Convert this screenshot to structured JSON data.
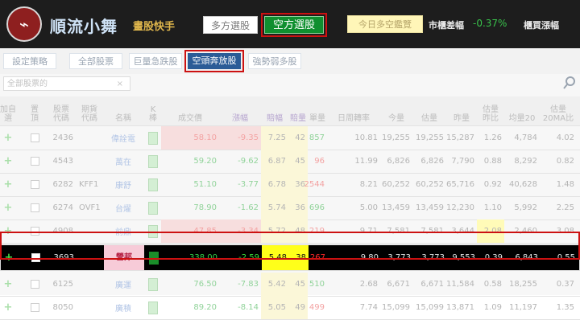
{
  "header": {
    "logo_glyph": "⌁",
    "brand": "順流小舞",
    "subtitle": "畫股快手",
    "tab_long": "多方選股",
    "tab_short": "空方選股",
    "today_label": "今日多空鑑覽",
    "market_label": "市櫃差幅",
    "market_value": "-0.37%",
    "category_label": "櫃買漲幅"
  },
  "strategies": {
    "setup": "設定策略",
    "all": "全部股票",
    "bullish": "巨量急跌股",
    "short_active": "空頭奔放股",
    "weak": "強勢弱多股"
  },
  "filter": {
    "placeholder": "全部股票的",
    "clear": "×"
  },
  "columns": [
    "加自\n選",
    "置\n頂",
    "股票\n代碼",
    "期貨\n代碼",
    "名稱",
    "K\n棒",
    "成交價",
    "漲幅",
    "賠幅",
    "賠量",
    "單量",
    "日周轉率",
    "今量",
    "估量",
    "昨量",
    "估量\n昨比",
    "均量20",
    "估量\n20MA比"
  ],
  "rows": [
    {
      "code": "2436",
      "fut": "",
      "name": "偉詮電",
      "price": "58.10",
      "chg": "-9.35",
      "p1": "7.25",
      "p2": "42",
      "vol": "857",
      "turn": "10.81",
      "today": "19,255",
      "est": "19,255",
      "yest": "15,287",
      "ratio": "1.26",
      "ma": "4,784",
      "ma_ratio": "4.02"
    },
    {
      "code": "4543",
      "fut": "",
      "name": "萬在",
      "price": "59.20",
      "chg": "-9.62",
      "p1": "6.87",
      "p2": "45",
      "vol": "96",
      "turn": "11.99",
      "today": "6,826",
      "est": "6,826",
      "yest": "7,790",
      "ratio": "0.88",
      "ma": "8,292",
      "ma_ratio": "0.82"
    },
    {
      "code": "6282",
      "fut": "KFF1",
      "name": "康舒",
      "price": "51.10",
      "chg": "-3.77",
      "p1": "6.78",
      "p2": "36",
      "vol": "2544",
      "turn": "8.21",
      "today": "60,252",
      "est": "60,252",
      "yest": "65,716",
      "ratio": "0.92",
      "ma": "40,628",
      "ma_ratio": "1.48"
    },
    {
      "code": "6274",
      "fut": "OVF1",
      "name": "台燿",
      "price": "78.90",
      "chg": "-1.62",
      "p1": "5.74",
      "p2": "36",
      "vol": "696",
      "turn": "5.00",
      "today": "13,459",
      "est": "13,459",
      "yest": "12,230",
      "ratio": "1.10",
      "ma": "5,992",
      "ma_ratio": "2.25"
    },
    {
      "code": "4908",
      "fut": "",
      "name": "前鼎",
      "price": "47.85",
      "chg": "-3.34",
      "p1": "5.72",
      "p2": "48",
      "vol": "219",
      "turn": "9.71",
      "today": "7,581",
      "est": "7,581",
      "yest": "3,644",
      "ratio": "2.08",
      "ma": "2,460",
      "ma_ratio": "3.08"
    },
    {
      "code": "3693",
      "fut": "",
      "name": "營邦",
      "price": "338.00",
      "chg": "-2.59",
      "p1": "5.48",
      "p2": "38",
      "vol": "267",
      "turn": "9.80",
      "today": "3,773",
      "est": "3,773",
      "yest": "9,553",
      "ratio": "0.39",
      "ma": "6,843",
      "ma_ratio": "0.55"
    },
    {
      "code": "6125",
      "fut": "",
      "name": "廣運",
      "price": "76.50",
      "chg": "-7.83",
      "p1": "5.42",
      "p2": "45",
      "vol": "510",
      "turn": "2.68",
      "today": "6,671",
      "est": "6,671",
      "yest": "11,584",
      "ratio": "0.58",
      "ma": "18,255",
      "ma_ratio": "0.37"
    },
    {
      "code": "8050",
      "fut": "",
      "name": "廣積",
      "price": "89.20",
      "chg": "-8.14",
      "p1": "5.05",
      "p2": "49",
      "vol": "499",
      "turn": "7.74",
      "today": "15,099",
      "est": "15,099",
      "yest": "13,871",
      "ratio": "1.09",
      "ma": "11,197",
      "ma_ratio": "1.35"
    }
  ],
  "plus_glyph": "+"
}
